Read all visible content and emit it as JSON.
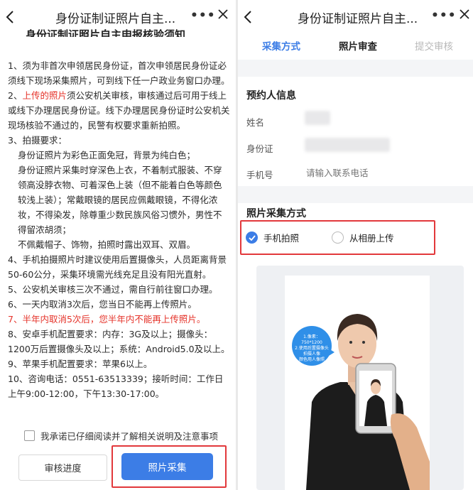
{
  "left_page": {
    "nav": {
      "title": "身份证制证照片自主...",
      "more": "•••"
    },
    "notice_title": "身份证制证照片自主申报核验须知",
    "notice": {
      "p1": "1、须为非首次申领居民身份证，首次申领居民身份证必须线下现场采集照片，可到线下任一户政业务窗口办理。",
      "p2_prefix": "2、",
      "p2_red": "上传的照片",
      "p2_rest": "须公安机关审核，审核通过后可用于线上或线下办理居民身份证。线下办理居民身份证时公安机关现场核验不通过的，民警有权要求重新拍照。",
      "p3": "3、拍摄要求：",
      "p3a": "身份证照片为彩色正面免冠，背景为纯白色；",
      "p3b": "身份证照片采集时穿深色上衣，不着制式服装、不穿领高没脖衣物、可着深色上装（但不能着白色等颜色较浅上装）；常戴眼镜的居民应佩戴眼镜，不得化浓妆，不得染发，除尊重少数民族风俗习惯外，男性不得留浓胡须；",
      "p3c": "不佩戴帽子、饰物，拍照时露出双耳、双眉。",
      "p4": "4、手机拍摄照片时建议使用后置摄像头，人员距离背景50-60公分，采集环境需光线充足且没有阳光直射。",
      "p5": "5、公安机关审核三次不通过，需自行前往窗口办理。",
      "p6": "6、一天内取消3次后，您当日不能再上传照片。",
      "p7": "7、半年内取消5次后，您半年内不能再上传照片。",
      "p8": "8、安卓手机配置要求：内存：3G及以上；摄像头：1200万后置摄像头及以上；系统：Android5.0及以上。",
      "p9": "9、苹果手机配置要求：苹果6以上。",
      "p10": "10、咨询电话：0551-63513339；接听时间：工作日上午9:00-12:00，下午13:30-17:00。"
    },
    "agree_text": "我承诺已仔细阅读并了解相关说明及注意事项",
    "btn_progress": "审核进度",
    "btn_capture": "照片采集"
  },
  "right_page": {
    "nav": {
      "title": "身份证制证照片自主...",
      "more": "•••"
    },
    "steps": [
      "采集方式",
      "照片审查",
      "提交审核"
    ],
    "appointee_title": "预约人信息",
    "fields": {
      "name": "姓名",
      "id": "身份证",
      "phone": "手机号"
    },
    "phone_placeholder": "请输入联系电话",
    "capture_title": "照片采集方式",
    "options": {
      "camera": "手机拍照",
      "album": "从相册上传"
    },
    "tip_lines": [
      "1.像素：",
      "750*1200",
      "2.使用后置摄像头",
      "拍摄人像",
      "颜色用人像照"
    ]
  },
  "colors": {
    "accent": "#3c7de6",
    "highlight": "#e2383b",
    "warning": "#e5332a"
  },
  "icons": [
    "back-icon",
    "more-icon",
    "close-icon",
    "check-icon"
  ]
}
